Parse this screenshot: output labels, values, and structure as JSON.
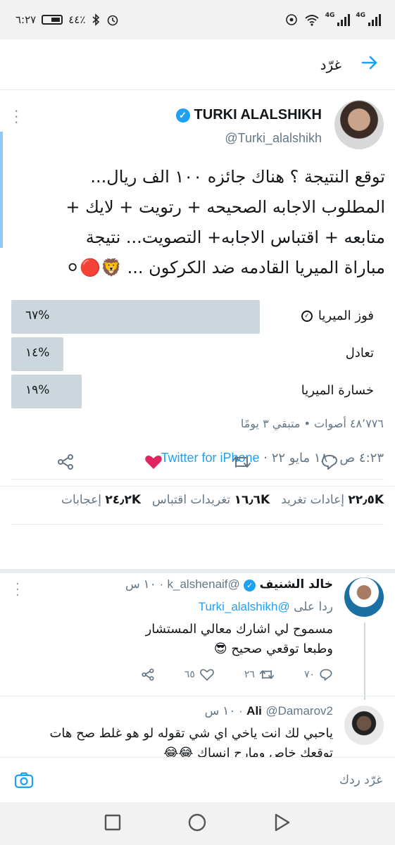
{
  "status_bar": {
    "time": "٦:٢٧",
    "battery": "٤٤٪",
    "net1": "4G",
    "net2": "4G"
  },
  "header": {
    "title": "غرّد",
    "back_icon": "arrow-right-icon"
  },
  "tweet": {
    "author_name": "TURKI ALALSHIKH",
    "handle": "@Turki_alalshikh",
    "text_lines": [
      "توقع النتيجة ؟ هناك جائزه ١٠٠ الف ريال...",
      "المطلوب الاجابه الصحيحه + رتويت + لايك +",
      "متابعه + اقتباس الاجابه+ التصويت... نتيجة",
      "مباراة الميريا القادمه ضد الكركون ... 🦁🔴⚪"
    ],
    "poll": {
      "options": [
        {
          "label": "فوز الميريا",
          "percent_text": "%٦٧",
          "percent": 67,
          "selected": true
        },
        {
          "label": "تعادل",
          "percent_text": "%١٤",
          "percent": 14,
          "selected": false
        },
        {
          "label": "خسارة الميريا",
          "percent_text": "%١٩",
          "percent": 19,
          "selected": false
        }
      ],
      "meta": "٤٨٬٧٧٦ أصوات • متبقي ٣ يومًا"
    },
    "timestamp": "٤:٢٣ ص · ١٨ مايو ٢٢ · ",
    "source": "Twitter for iPhone",
    "stats": {
      "retweets_count": "٢٢٫٥K",
      "retweets_label": "إعادات تغريد",
      "quotes_count": "١٦٫٦K",
      "quotes_label": "تغريدات اقتباس",
      "likes_count": "٢٤٫٢K",
      "likes_label": "إعجابات"
    },
    "actions": [
      "reply-icon",
      "retweet-icon",
      "like-icon",
      "share-icon"
    ],
    "liked_color": "#e0245e"
  },
  "replies": [
    {
      "name": "خالد الشنيف",
      "handle": "@k_alshenaif",
      "time": "١٠ س",
      "replying_prefix": "ردا على ",
      "replying_to": "@Turki_alalshikh",
      "body_lines": [
        "مسموح لي اشارك معالي المستشار",
        "وطبعا توقعي صحيح 😎"
      ],
      "reply_count": "٧٠",
      "retweet_count": "٢٦",
      "like_count": "٦٥"
    },
    {
      "name": "Ali",
      "handle": "@Damarov2",
      "time": "١٠ س",
      "body_lines": [
        "ياحبي لك انت ياخي اي شي تقوله لو هو غلط صح هات",
        "توقعك خاص ومارح انساك 😂😂"
      ]
    }
  ],
  "compose": {
    "placeholder": "غرّد ردك",
    "camera_icon": "camera-icon"
  },
  "nav": [
    "back-triangle-icon",
    "home-circle-icon",
    "recents-square-icon"
  ],
  "colors": {
    "accent": "#1da1f2",
    "muted": "#657786",
    "poll_bar": "#ccd6dd"
  }
}
